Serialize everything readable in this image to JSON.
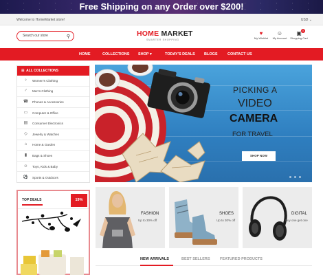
{
  "promo_bar": {
    "text": "Free Shipping on any Order over $200!"
  },
  "utility_bar": {
    "welcome": "Welcome to HomeMarket store!",
    "currency": "USD ⌄"
  },
  "header": {
    "search_placeholder": "Search our store",
    "logo_home": "HOME",
    "logo_market": "MARKET",
    "tagline": "SMARTER SHOPPING",
    "icons": [
      {
        "name": "heart-icon",
        "glyph": "♥",
        "label": "My Wishlist"
      },
      {
        "name": "user-icon",
        "glyph": "☺",
        "label": "My Account"
      },
      {
        "name": "cart-icon",
        "glyph": "▣",
        "label": "Shopping Cart",
        "count": "0"
      }
    ]
  },
  "nav": {
    "items": [
      "HOME",
      "COLLECTIONS",
      "SHOP ▾",
      "TODAY'S DEALS",
      "BLOGS",
      "CONTACT US"
    ]
  },
  "sidebar": {
    "header": "ALL COLLECTIONS",
    "items": [
      {
        "label": "Women's Clothing",
        "icon": "dress-icon",
        "glyph": "♀"
      },
      {
        "label": "Men's Clothing",
        "icon": "shirt-icon",
        "glyph": "♂"
      },
      {
        "label": "Phones & Accessories",
        "icon": "phone-icon",
        "glyph": "☎"
      },
      {
        "label": "Computer & Office",
        "icon": "computer-icon",
        "glyph": "▭"
      },
      {
        "label": "Consumer Electronics",
        "icon": "electronics-icon",
        "glyph": "▤"
      },
      {
        "label": "Jewelry & Watches",
        "icon": "jewelry-icon",
        "glyph": "◇"
      },
      {
        "label": "Home & Garden",
        "icon": "home-icon",
        "glyph": "⌂"
      },
      {
        "label": "Bags & Shoes",
        "icon": "bag-icon",
        "glyph": "▮"
      },
      {
        "label": "Toys, Kids & Baby",
        "icon": "toys-icon",
        "glyph": "☺"
      },
      {
        "label": "Sports & Outdoors",
        "icon": "sports-icon",
        "glyph": "⚽"
      }
    ]
  },
  "hero": {
    "line1": "PICKING A",
    "line2": "VIDEO",
    "line3": "CAMERA",
    "line4": "FOR TRAVEL",
    "button": "SHOP NOW"
  },
  "top_deals": {
    "title": "TOP DEALS",
    "badge": "19%"
  },
  "tiles": [
    {
      "name": "FASHION",
      "sub": "Up to 30% off"
    },
    {
      "name": "SHOES",
      "sub": "Up to 30% off"
    },
    {
      "name": "DIGITAL",
      "sub": "Buy one get one"
    }
  ],
  "product_tabs": [
    "NEW ARRIVALS",
    "BEST SELLERS",
    "FEATURED PRODUCTS"
  ],
  "colors": {
    "accent": "#e31b23",
    "hero_bg": "#3a8fd0"
  }
}
